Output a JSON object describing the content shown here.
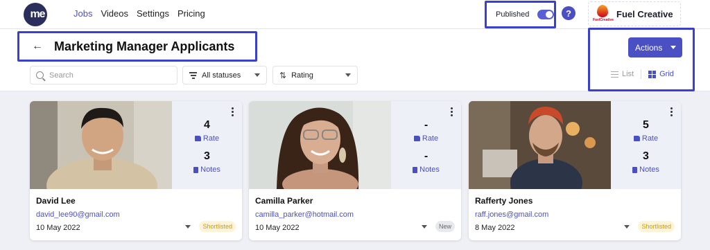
{
  "nav": {
    "logo_text": "me",
    "links": [
      {
        "label": "Jobs",
        "active": true
      },
      {
        "label": "Videos",
        "active": false
      },
      {
        "label": "Settings",
        "active": false
      },
      {
        "label": "Pricing",
        "active": false
      }
    ],
    "published_label": "Published",
    "published_on": true,
    "help_label": "?",
    "company_name": "Fuel Creative",
    "company_logo_text": "FuelCreative"
  },
  "page": {
    "title": "Marketing Manager Applicants",
    "search_placeholder": "Search",
    "status_filter": "All statuses",
    "sort_by": "Rating",
    "actions_label": "Actions",
    "view_list": "List",
    "view_grid": "Grid",
    "active_view": "Grid"
  },
  "colors": {
    "accent": "#4b4fc4",
    "highlight_border": "#3b3fd0",
    "shortlisted_bg": "#fff4d6",
    "shortlisted_text": "#c89a15"
  },
  "applicants": [
    {
      "name": "David Lee",
      "email": "david_lee90@gmail.com",
      "date": "10 May 2022",
      "rate": "4",
      "rate_label": "Rate",
      "notes": "3",
      "notes_label": "Notes",
      "status": "Shortlisted"
    },
    {
      "name": "Camilla Parker",
      "email": "camilla_parker@hotmail.com",
      "date": "10 May 2022",
      "rate": "-",
      "rate_label": "Rate",
      "notes": "-",
      "notes_label": "Notes",
      "status": "New"
    },
    {
      "name": "Rafferty Jones",
      "email": "raff.jones@gmail.com",
      "date": "8 May 2022",
      "rate": "5",
      "rate_label": "Rate",
      "notes": "3",
      "notes_label": "Notes",
      "status": "Shortlisted"
    }
  ]
}
